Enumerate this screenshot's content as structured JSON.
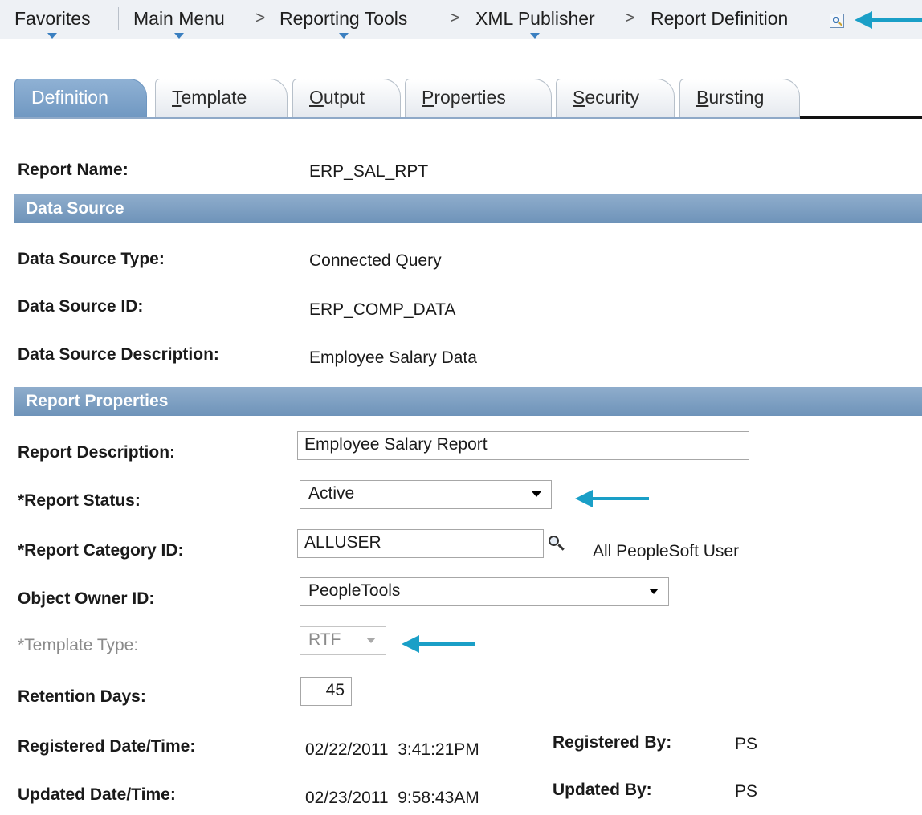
{
  "breadcrumb": {
    "favorites": "Favorites",
    "main_menu": "Main Menu",
    "reporting_tools": "Reporting Tools",
    "xml_publisher": "XML Publisher",
    "report_definition": "Report Definition",
    "separator": ">"
  },
  "tabs": [
    {
      "label": "Definition",
      "active": true
    },
    {
      "label": "Template",
      "underline": "T"
    },
    {
      "label": "Output",
      "underline": "O"
    },
    {
      "label": "Properties",
      "underline": "P"
    },
    {
      "label": "Security",
      "underline": "S"
    },
    {
      "label": "Bursting",
      "underline": "B"
    }
  ],
  "report": {
    "name_label": "Report Name:",
    "name_value": "ERP_SAL_RPT"
  },
  "data_source": {
    "header": "Data Source",
    "type_label": "Data Source Type:",
    "type_value": "Connected Query",
    "id_label": "Data Source ID:",
    "id_value": "ERP_COMP_DATA",
    "description_label": "Data Source Description:",
    "description_value": "Employee Salary Data"
  },
  "report_properties": {
    "header": "Report Properties",
    "description_label": "Report Description:",
    "description_value": "Employee Salary Report",
    "status_label": "*Report Status:",
    "status_value": "Active",
    "category_label": "*Report Category ID:",
    "category_value": "ALLUSER",
    "category_description": "All PeopleSoft User",
    "owner_label": "Object Owner ID:",
    "owner_value": "PeopleTools",
    "template_type_label": "*Template Type:",
    "template_type_value": "RTF",
    "retention_label": "Retention Days:",
    "retention_value": "45",
    "registered_dt_label": "Registered Date/Time:",
    "registered_dt_value": "02/22/2011  3:41:21PM",
    "registered_by_label": "Registered By:",
    "registered_by_value": "PS",
    "updated_dt_label": "Updated Date/Time:",
    "updated_dt_value": "02/23/2011  9:58:43AM",
    "updated_by_label": "Updated By:",
    "updated_by_value": "PS"
  },
  "colors": {
    "callout_arrow": "#1a9fc7",
    "section_header": "#7b9cc2",
    "active_tab": "#7fa3ca"
  },
  "icons": {
    "breadcrumb_search": "search-page-icon",
    "category_lookup": "magnifier-lookup-icon",
    "callout": "left-arrow-callout"
  }
}
